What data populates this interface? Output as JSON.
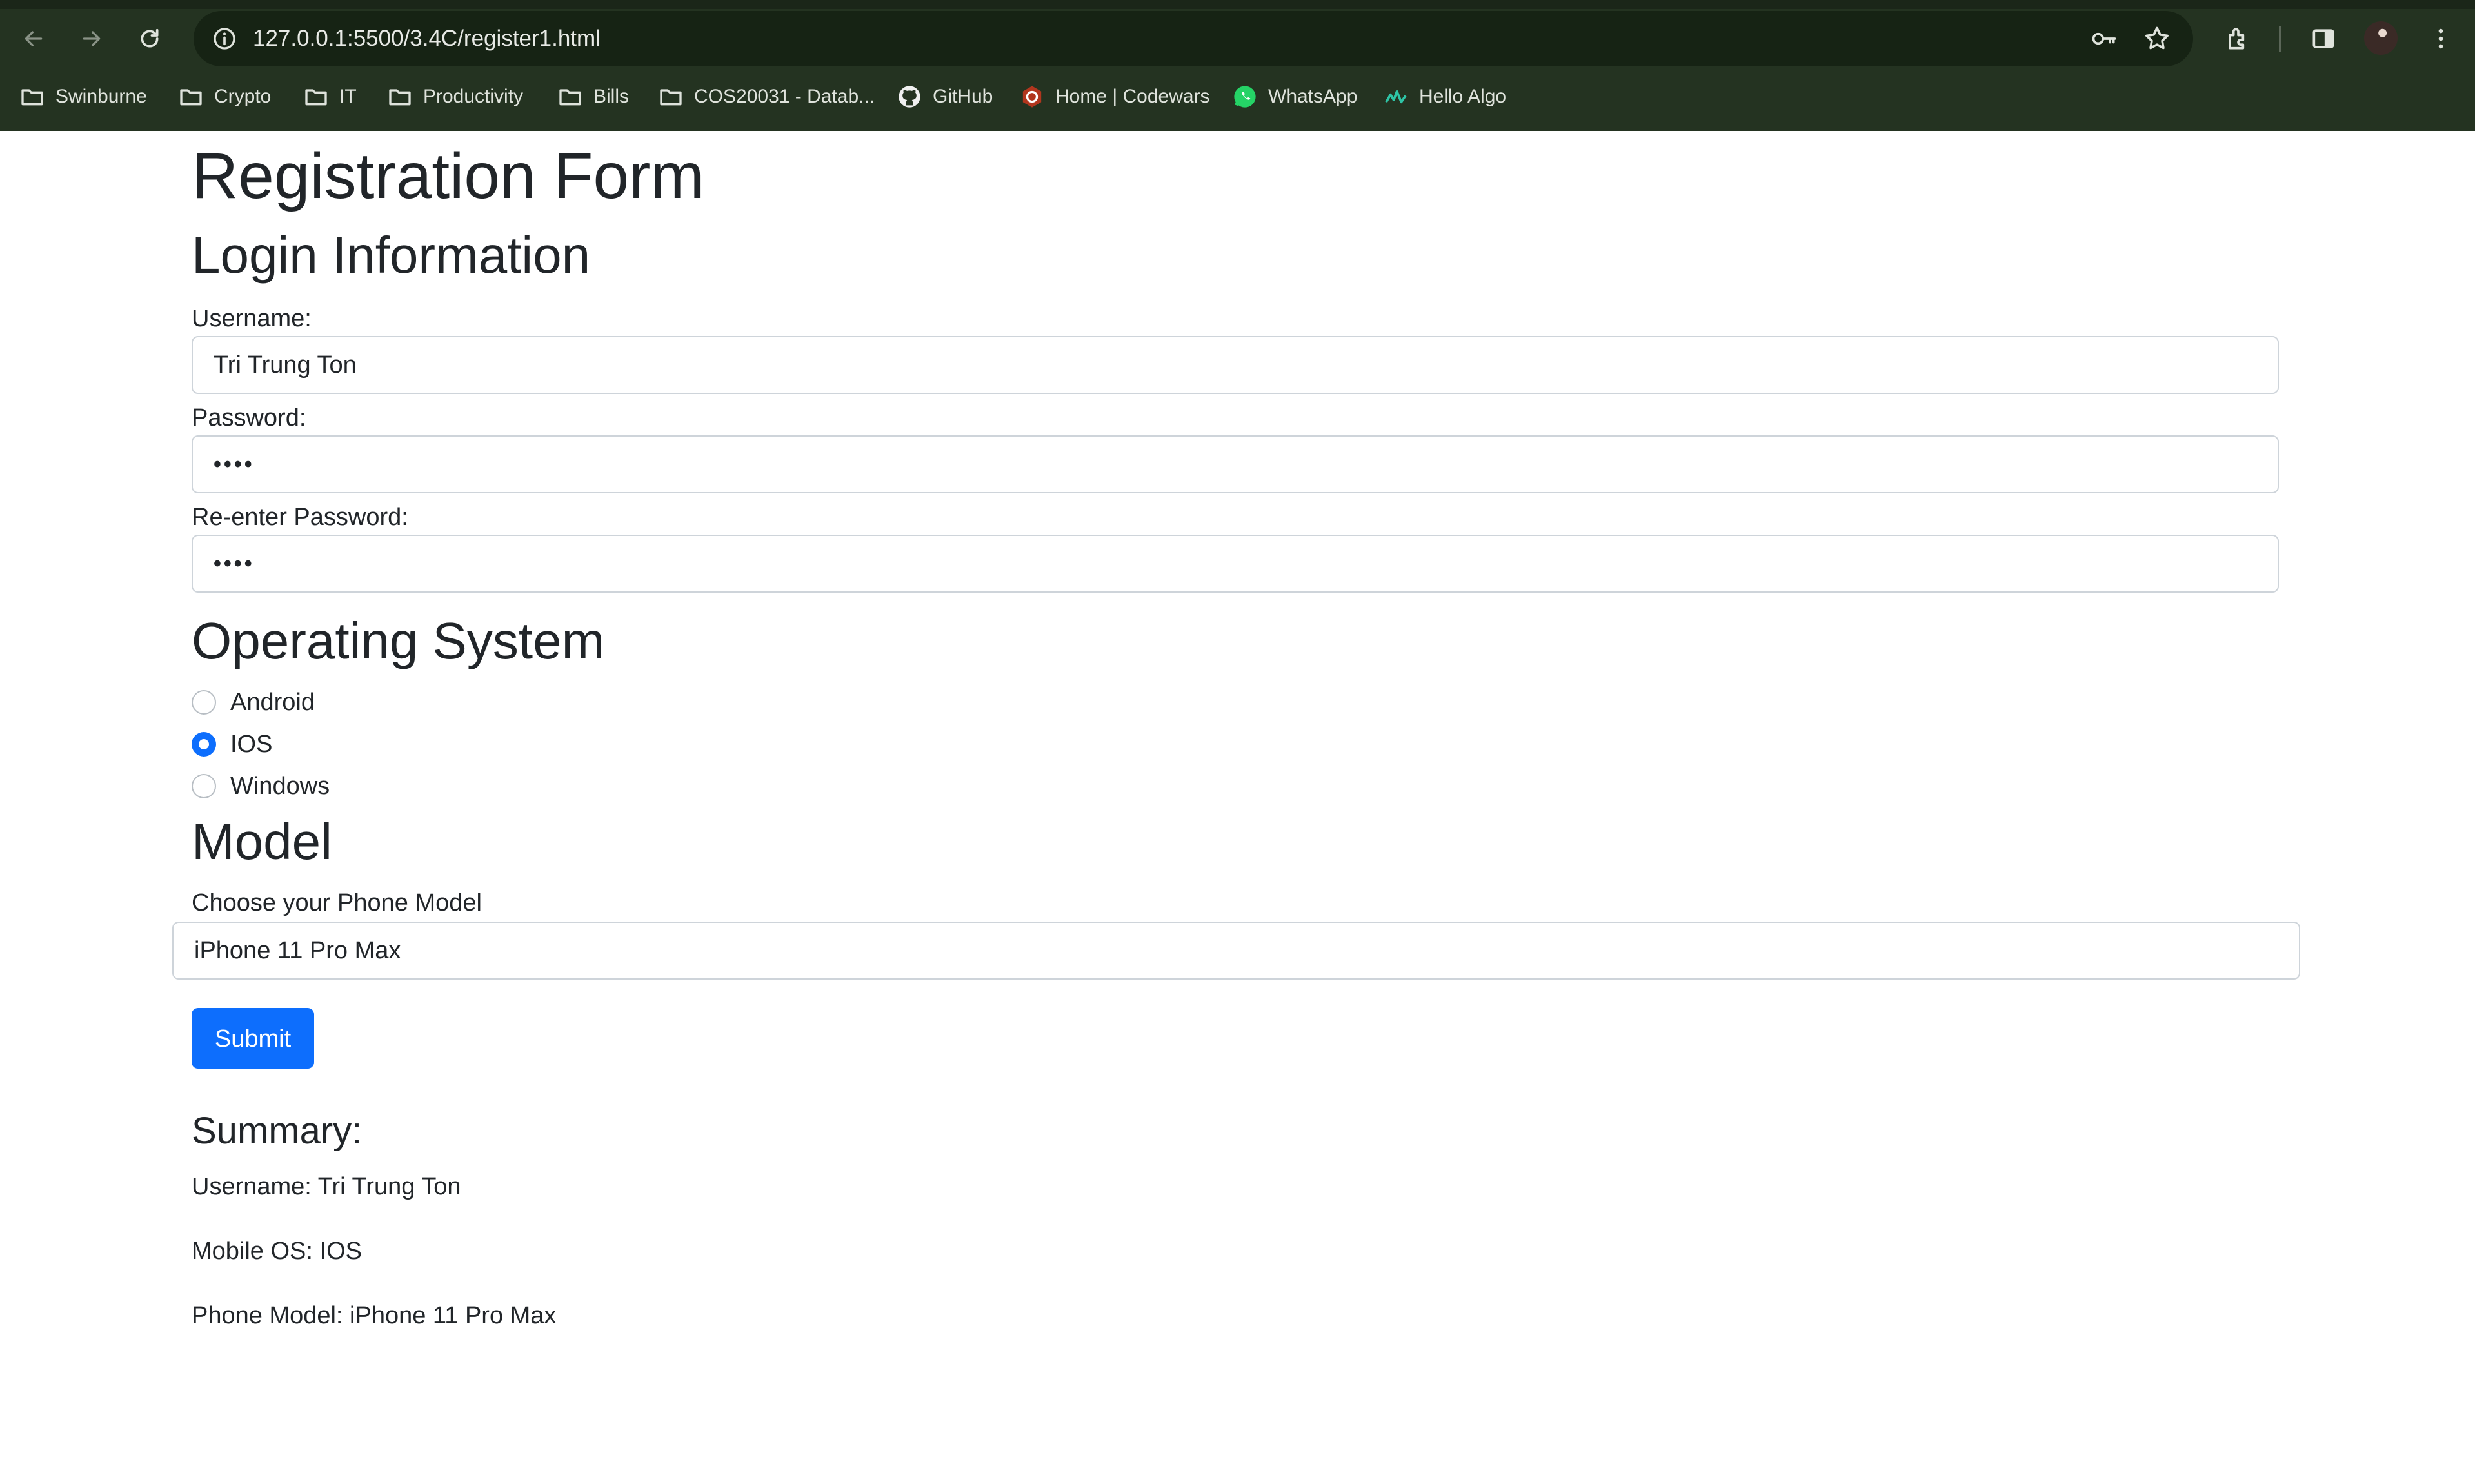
{
  "browser": {
    "url": "127.0.0.1:5500/3.4C/register1.html",
    "bookmarks": [
      {
        "label": "Swinburne",
        "icon": "folder-icon"
      },
      {
        "label": "Crypto",
        "icon": "folder-icon"
      },
      {
        "label": "IT",
        "icon": "folder-icon"
      },
      {
        "label": "Productivity",
        "icon": "folder-icon"
      },
      {
        "label": "Bills",
        "icon": "folder-icon"
      },
      {
        "label": "COS20031 - Datab...",
        "icon": "folder-icon"
      },
      {
        "label": "GitHub",
        "icon": "github-icon"
      },
      {
        "label": "Home | Codewars",
        "icon": "codewars-icon"
      },
      {
        "label": "WhatsApp",
        "icon": "whatsapp-icon"
      },
      {
        "label": "Hello Algo",
        "icon": "hello-algo-icon"
      }
    ],
    "colors": {
      "frame": "#243321",
      "omnibox": "#162314",
      "text": "#e8eae6"
    }
  },
  "form": {
    "title": "Registration Form",
    "login_heading": "Login Information",
    "username_label": "Username:",
    "username_value": "Tri Trung Ton",
    "password_label": "Password:",
    "password_value": "••••",
    "reenter_label": "Re-enter Password:",
    "reenter_value": "••••",
    "os_heading": "Operating System",
    "os_options": [
      {
        "label": "Android",
        "checked": false
      },
      {
        "label": "IOS",
        "checked": true
      },
      {
        "label": "Windows",
        "checked": false
      }
    ],
    "model_heading": "Model",
    "model_label": "Choose your Phone Model",
    "model_value": "iPhone 11 Pro Max",
    "submit_label": "Submit",
    "accent": "#0d6efd"
  },
  "summary": {
    "heading": "Summary:",
    "username": "Username: Tri Trung Ton",
    "os": "Mobile OS: IOS",
    "model": "Phone Model: iPhone 11 Pro Max"
  }
}
